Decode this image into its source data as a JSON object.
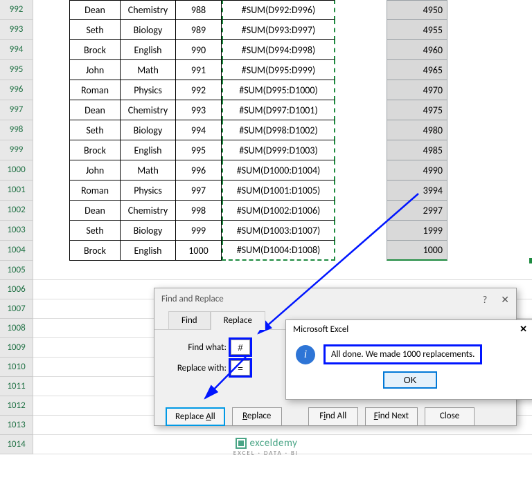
{
  "row_start": 992,
  "rows": [
    {
      "b": "Dean",
      "c": "Chemistry",
      "d": "988",
      "e": "#SUM(D992:D996)",
      "g": "4950"
    },
    {
      "b": "Seth",
      "c": "Biology",
      "d": "989",
      "e": "#SUM(D993:D997)",
      "g": "4955"
    },
    {
      "b": "Brock",
      "c": "English",
      "d": "990",
      "e": "#SUM(D994:D998)",
      "g": "4960"
    },
    {
      "b": "John",
      "c": "Math",
      "d": "991",
      "e": "#SUM(D995:D999)",
      "g": "4965"
    },
    {
      "b": "Roman",
      "c": "Physics",
      "d": "992",
      "e": "#SUM(D995:D1000)",
      "g": "4970"
    },
    {
      "b": "Dean",
      "c": "Chemistry",
      "d": "993",
      "e": "#SUM(D997:D1001)",
      "g": "4975"
    },
    {
      "b": "Seth",
      "c": "Biology",
      "d": "994",
      "e": "#SUM(D998:D1002)",
      "g": "4980"
    },
    {
      "b": "Brock",
      "c": "English",
      "d": "995",
      "e": "#SUM(D999:D1003)",
      "g": "4985"
    },
    {
      "b": "John",
      "c": "Math",
      "d": "996",
      "e": "#SUM(D1000:D1004)",
      "g": "4990"
    },
    {
      "b": "Roman",
      "c": "Physics",
      "d": "997",
      "e": "#SUM(D1001:D1005)",
      "g": "3994"
    },
    {
      "b": "Dean",
      "c": "Chemistry",
      "d": "998",
      "e": "#SUM(D1002:D1006)",
      "g": "2997"
    },
    {
      "b": "Seth",
      "c": "Biology",
      "d": "999",
      "e": "#SUM(D1003:D1007)",
      "g": "1999"
    },
    {
      "b": "Brock",
      "c": "English",
      "d": "1000",
      "e": "#SUM(D1004:D1008)",
      "g": "1000"
    }
  ],
  "empty_rows": [
    "1005",
    "1006",
    "1007",
    "1008",
    "1009",
    "1010",
    "1011",
    "1012",
    "1013",
    "1014"
  ],
  "find_replace": {
    "title": "Find and Replace",
    "help": "?",
    "tabs": {
      "find": "Find",
      "replace": "Replace"
    },
    "find_label": "Find what:",
    "find_value": "#",
    "replace_label": "Replace with:",
    "replace_value": "=",
    "buttons": {
      "replace_all": "Replace All",
      "replace": "Replace",
      "find_all": "Find All",
      "find_next": "Find Next",
      "close": "Close"
    }
  },
  "msgbox": {
    "title": "Microsoft Excel",
    "text": "All done. We made 1000 replacements.",
    "ok": "OK"
  },
  "watermark": {
    "brand": "exceldemy",
    "sub": "EXCEL · DATA · BI"
  }
}
